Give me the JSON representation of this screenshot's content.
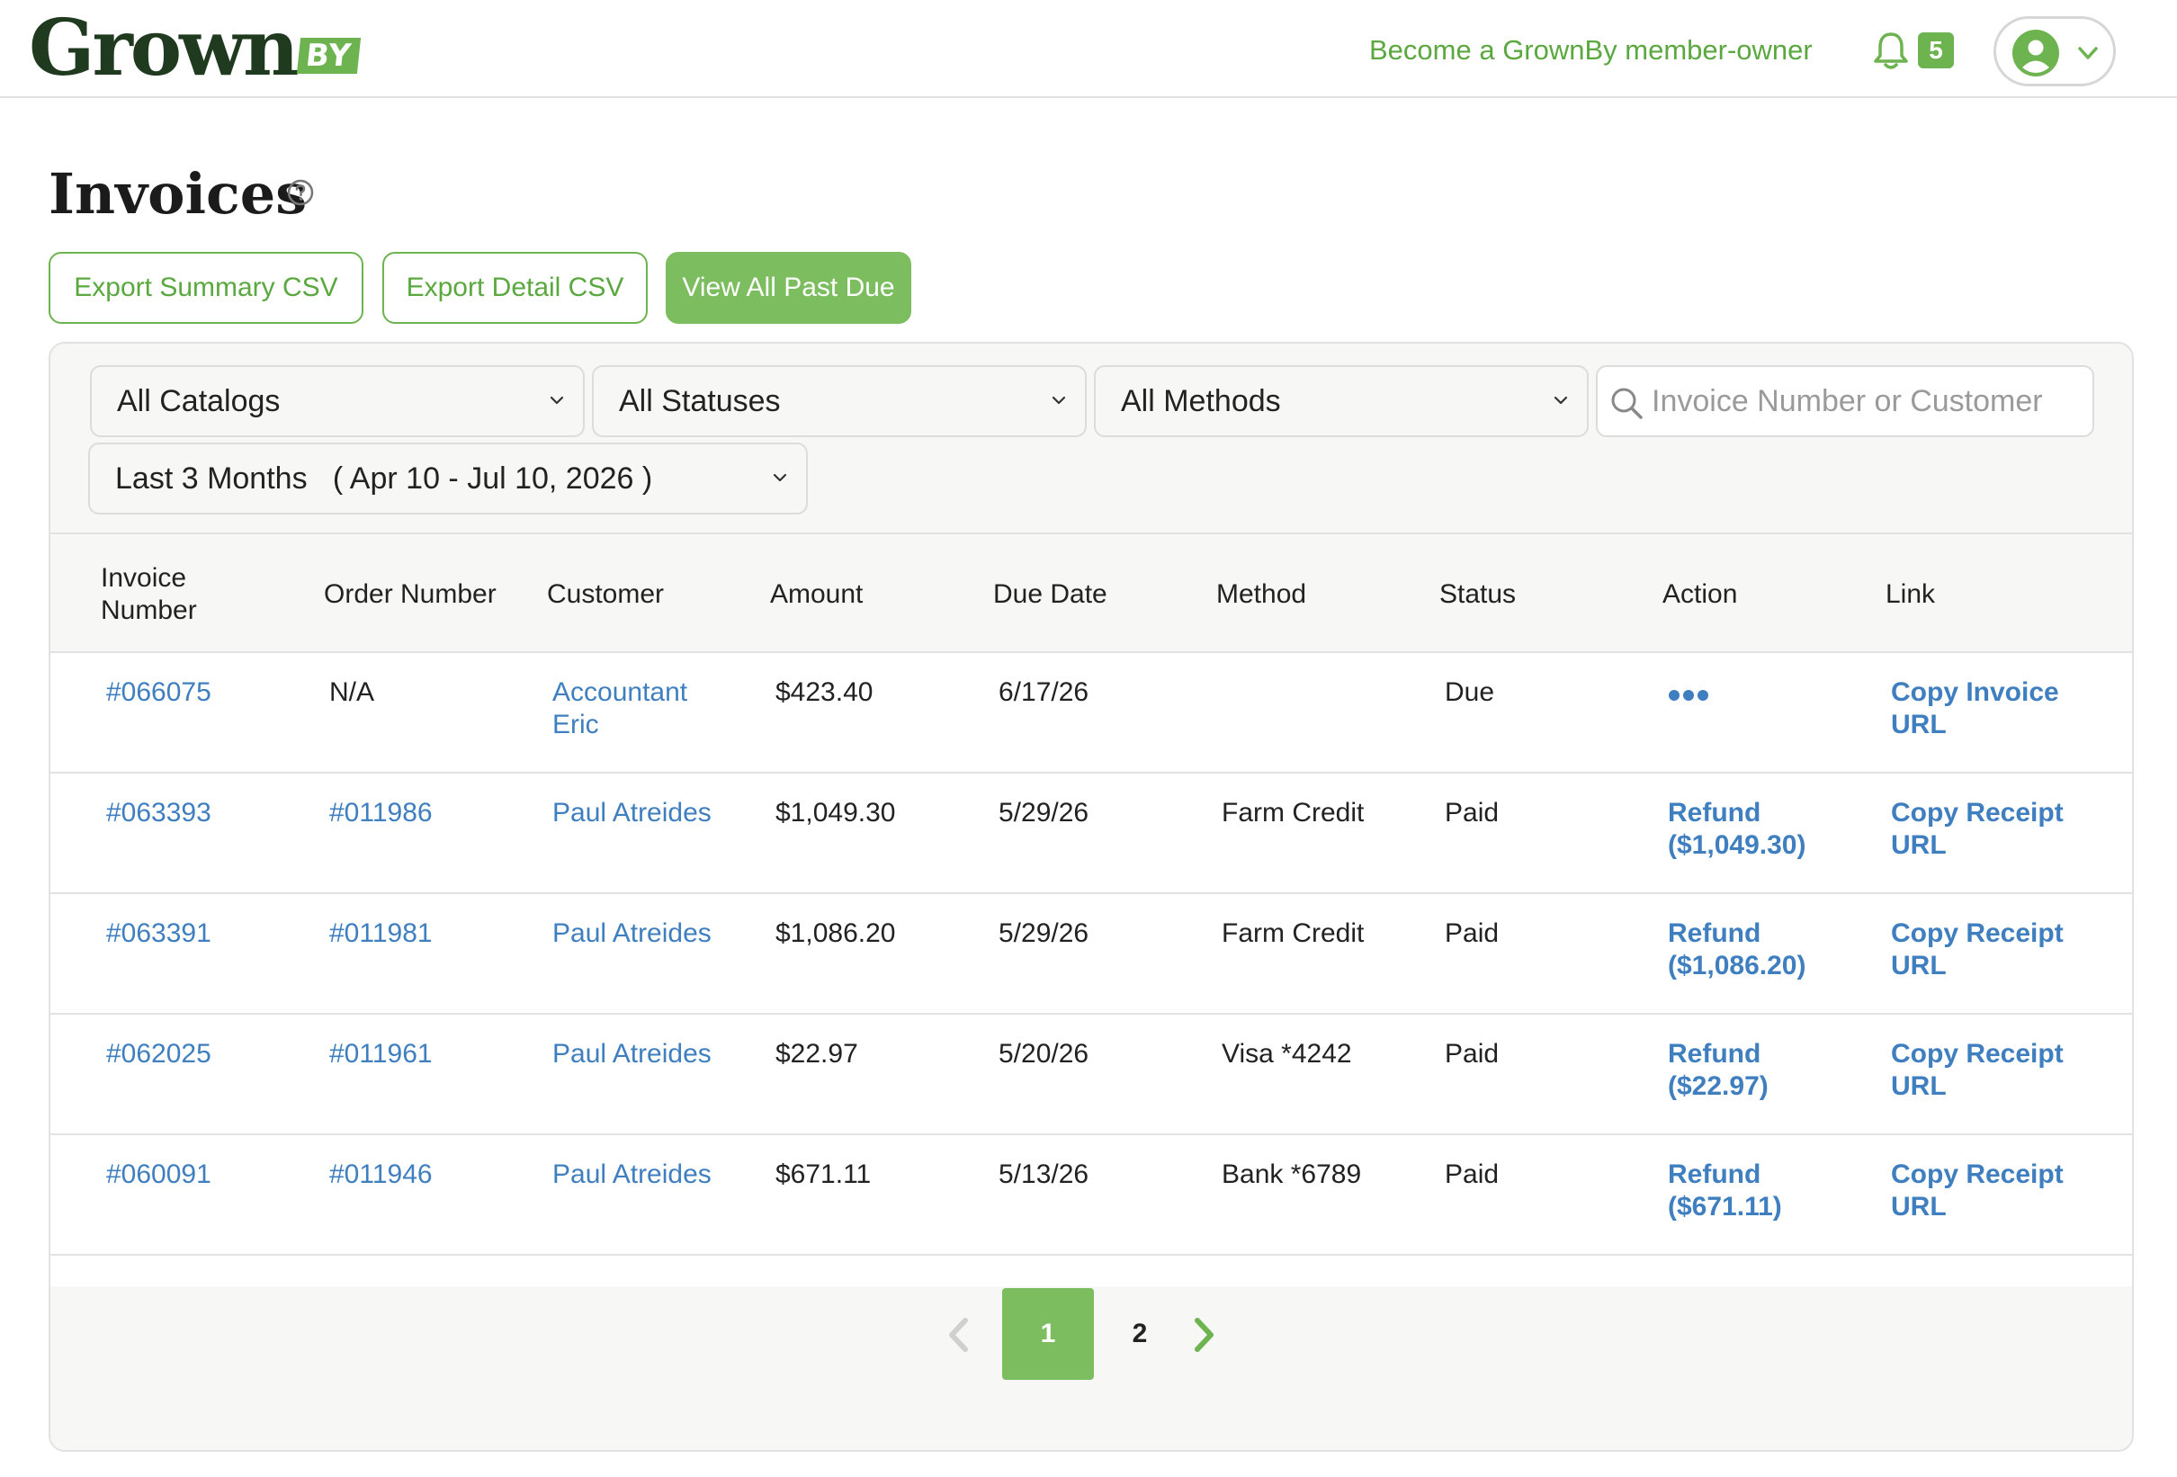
{
  "header": {
    "logo_word": "Grown",
    "logo_badge": "BY",
    "member_link": "Become a GrownBy member-owner",
    "notification_count": "5"
  },
  "page": {
    "title": "Invoices"
  },
  "actions": {
    "export_summary": "Export Summary CSV",
    "export_detail": "Export Detail CSV",
    "view_past_due": "View All Past Due"
  },
  "filters": {
    "catalogs": "All Catalogs",
    "statuses": "All Statuses",
    "methods": "All Methods",
    "search_placeholder": "Invoice Number or Customer",
    "range_label": "Last 3 Months",
    "range_dates": "( Apr 10 - Jul 10, 2026 )"
  },
  "table": {
    "columns": [
      "Invoice Number",
      "Order Number",
      "Customer",
      "Amount",
      "Due Date",
      "Method",
      "Status",
      "Action",
      "Link"
    ],
    "rows": [
      {
        "invoice": "#066075",
        "order": "N/A",
        "customer": "Accountant Eric",
        "amount": "$423.40",
        "due": "6/17/26",
        "method": "",
        "status": "Due",
        "action": "",
        "link": "Copy Invoice URL"
      },
      {
        "invoice": "#063393",
        "order": "#011986",
        "customer": "Paul Atreides",
        "amount": "$1,049.30",
        "due": "5/29/26",
        "method": "Farm Credit",
        "status": "Paid",
        "action": "Refund ($1,049.30)",
        "link": "Copy Receipt URL"
      },
      {
        "invoice": "#063391",
        "order": "#011981",
        "customer": "Paul Atreides",
        "amount": "$1,086.20",
        "due": "5/29/26",
        "method": "Farm Credit",
        "status": "Paid",
        "action": "Refund ($1,086.20)",
        "link": "Copy Receipt URL"
      },
      {
        "invoice": "#062025",
        "order": "#011961",
        "customer": "Paul Atreides",
        "amount": "$22.97",
        "due": "5/20/26",
        "method": "Visa *4242",
        "status": "Paid",
        "action": "Refund ($22.97)",
        "link": "Copy Receipt URL"
      },
      {
        "invoice": "#060091",
        "order": "#011946",
        "customer": "Paul Atreides",
        "amount": "$671.11",
        "due": "5/13/26",
        "method": "Bank *6789",
        "status": "Paid",
        "action": "Refund ($671.11)",
        "link": "Copy Receipt URL"
      }
    ]
  },
  "pagination": {
    "current": "1",
    "next_page": "2"
  },
  "colors": {
    "brand_green": "#6db34f",
    "link_blue": "#3f7fbf",
    "logo_dark": "#1f3a1e"
  },
  "icons": [
    "bell-icon",
    "avatar-icon",
    "chevron-down-icon",
    "help-icon",
    "search-icon",
    "more-dots-icon",
    "chevron-left-icon",
    "chevron-right-icon"
  ]
}
